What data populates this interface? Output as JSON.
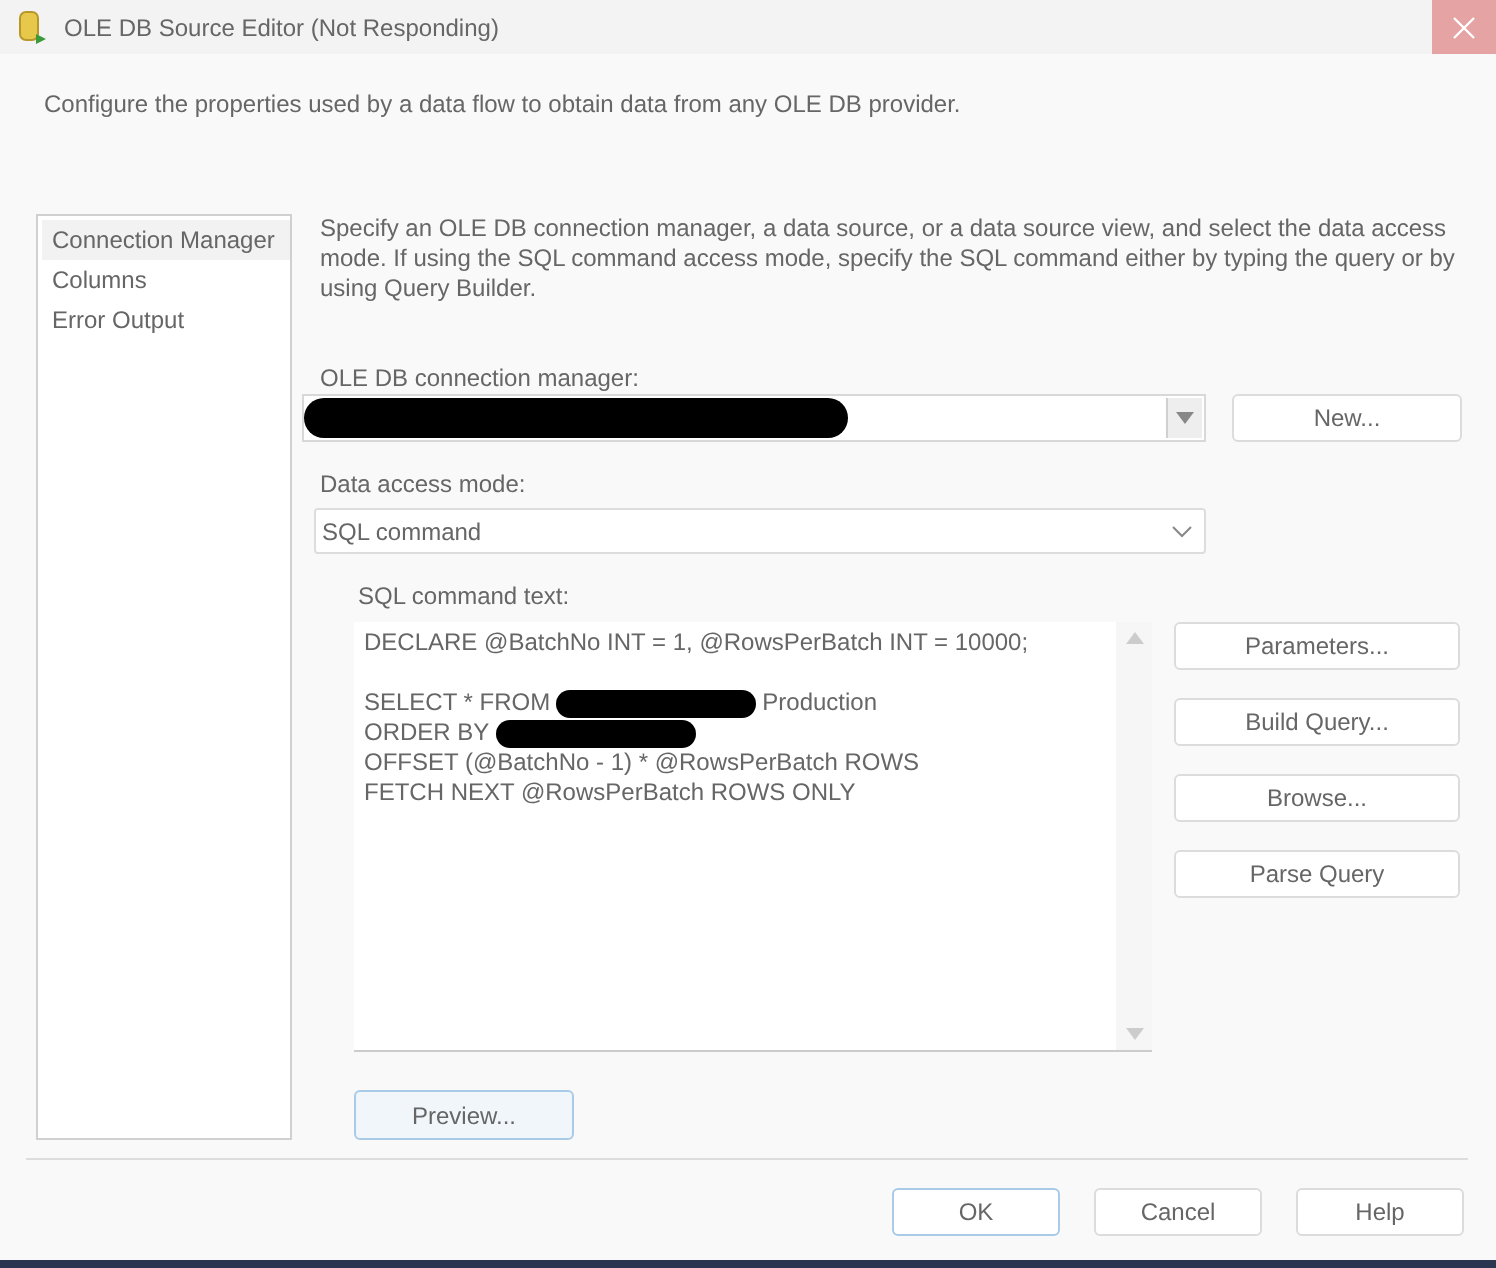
{
  "window": {
    "title": "OLE DB Source Editor (Not Responding)"
  },
  "description": "Configure the properties used by a data flow to obtain data from any OLE DB provider.",
  "sidebar": {
    "items": [
      {
        "label": "Connection Manager",
        "selected": true
      },
      {
        "label": "Columns",
        "selected": false
      },
      {
        "label": "Error Output",
        "selected": false
      }
    ]
  },
  "instructions": "Specify an OLE DB connection manager, a data source, or a data source view, and select the data access mode. If using the SQL command access mode, specify the SQL command either by typing the query or by using Query Builder.",
  "connection_manager": {
    "label": "OLE DB connection manager:",
    "redacted": true,
    "button": "New..."
  },
  "data_access_mode": {
    "label": "Data access mode:",
    "value": "SQL command"
  },
  "sql_command": {
    "label": "SQL command text:",
    "lines": [
      {
        "parts": [
          {
            "kind": "text",
            "text": "DECLARE @BatchNo INT = 1, @RowsPerBatch INT = 10000;"
          }
        ]
      },
      {
        "gap_before": true,
        "parts": [
          {
            "kind": "text",
            "text": "SELECT * FROM"
          },
          {
            "kind": "redaction"
          },
          {
            "kind": "text",
            "text": "Production"
          }
        ]
      },
      {
        "parts": [
          {
            "kind": "text",
            "text": "ORDER BY"
          },
          {
            "kind": "redaction"
          }
        ]
      },
      {
        "parts": [
          {
            "kind": "text",
            "text": "OFFSET (@BatchNo - 1) * @RowsPerBatch ROWS"
          }
        ]
      },
      {
        "parts": [
          {
            "kind": "text",
            "text": "FETCH NEXT @RowsPerBatch ROWS ONLY"
          }
        ]
      }
    ]
  },
  "side_buttons": [
    "Parameters...",
    "Build Query...",
    "Browse...",
    "Parse Query"
  ],
  "preview_button": "Preview...",
  "footer_buttons": [
    {
      "label": "OK",
      "default": true
    },
    {
      "label": "Cancel",
      "default": false
    },
    {
      "label": "Help",
      "default": false
    }
  ]
}
